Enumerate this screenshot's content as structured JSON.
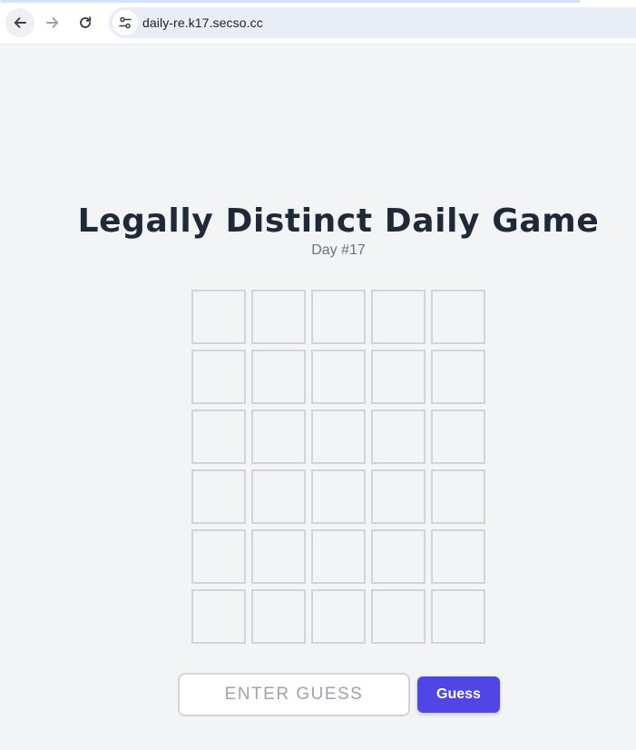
{
  "browser": {
    "url": "daily-re.k17.secso.cc",
    "icons": {
      "back": "arrow-left-icon",
      "forward": "arrow-right-icon",
      "reload": "reload-icon",
      "site_info": "tune-icon"
    }
  },
  "game": {
    "title": "Legally Distinct Daily Game",
    "subtitle": "Day #17",
    "board": {
      "rows": [
        [
          "",
          "",
          "",
          "",
          ""
        ],
        [
          "",
          "",
          "",
          "",
          ""
        ],
        [
          "",
          "",
          "",
          "",
          ""
        ],
        [
          "",
          "",
          "",
          "",
          ""
        ],
        [
          "",
          "",
          "",
          "",
          ""
        ],
        [
          "",
          "",
          "",
          "",
          ""
        ]
      ]
    },
    "input": {
      "value": "",
      "placeholder": "ENTER GUESS"
    },
    "guess_button_label": "Guess"
  },
  "colors": {
    "background": "#f3f4f6",
    "title": "#1f2937",
    "subtitle": "#6b7280",
    "tile_border": "#d1d5db",
    "button": "#4f46e5"
  }
}
